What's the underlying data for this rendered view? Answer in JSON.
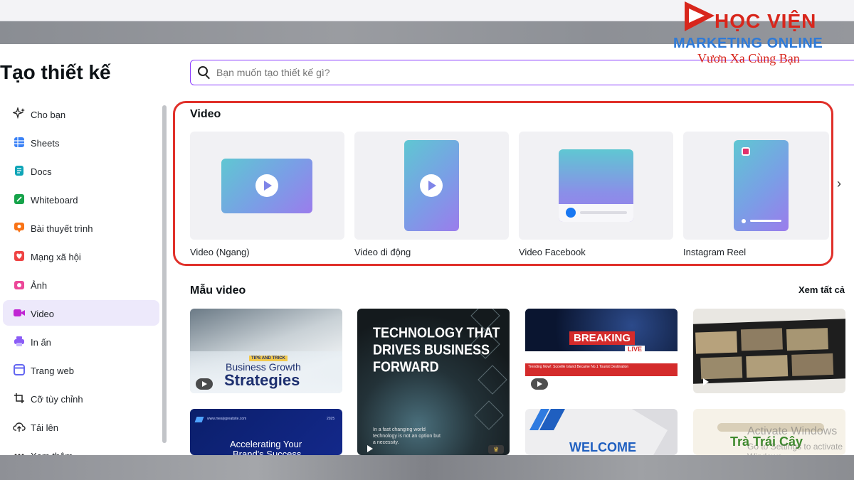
{
  "brand": {
    "line1": "HỌC VIỆN",
    "line2": "MARKETING ONLINE",
    "slogan": "Vươn Xa Cùng Bạn"
  },
  "page_title": "Tạo thiết kế",
  "search": {
    "placeholder": "Bạn muốn tạo thiết kế gì?"
  },
  "sidebar": {
    "items": [
      {
        "label": "Cho bạn",
        "icon": "sparkle-icon",
        "color": "#222222"
      },
      {
        "label": "Sheets",
        "icon": "sheets-icon",
        "color": "#3b82f6"
      },
      {
        "label": "Docs",
        "icon": "docs-icon",
        "color": "#0ea5b7"
      },
      {
        "label": "Whiteboard",
        "icon": "whiteboard-icon",
        "color": "#16a34a"
      },
      {
        "label": "Bài thuyết trình",
        "icon": "presentation-icon",
        "color": "#f97316"
      },
      {
        "label": "Mạng xã hội",
        "icon": "heart-icon",
        "color": "#ef4444"
      },
      {
        "label": "Ảnh",
        "icon": "camera-icon",
        "color": "#ec4899"
      },
      {
        "label": "Video",
        "icon": "video-icon",
        "color": "#c026d3",
        "active": true
      },
      {
        "label": "In ấn",
        "icon": "printer-icon",
        "color": "#8b5cf6"
      },
      {
        "label": "Trang web",
        "icon": "web-icon",
        "color": "#6366f1"
      },
      {
        "label": "Cỡ tùy chỉnh",
        "icon": "crop-icon",
        "color": "#222222"
      },
      {
        "label": "Tải lên",
        "icon": "cloud-upload-icon",
        "color": "#222222"
      },
      {
        "label": "Xem thêm",
        "icon": "more-icon",
        "color": "#222222"
      }
    ]
  },
  "video_section": {
    "title": "Video",
    "cards": [
      {
        "label": "Video (Ngang)"
      },
      {
        "label": "Video di động"
      },
      {
        "label": "Video Facebook"
      },
      {
        "label": "Instagram Reel"
      }
    ]
  },
  "templates_section": {
    "title": "Mẫu video",
    "see_all": "Xem tất cả",
    "templates": [
      {
        "tag": "TIPS AND TRICK",
        "line1": "Business Growth",
        "line2": "Strategies"
      },
      {
        "line1": "TECHNOLOGY THAT",
        "line2": "DRIVES BUSINESS",
        "line3": "FORWARD",
        "caption": "In a fast changing world technology is not an option but a necessity."
      },
      {
        "headline": "BREAKING",
        "badge": "LIVE",
        "ticker": "Trending Now!: Scoville Island Became No.1 Tourist Destination"
      },
      {
        "kind": "film-strip"
      },
      {
        "site": "www.mealygreatsite.com",
        "year": "2025",
        "line1": "Accelerating Your",
        "line2": "Brand's Success"
      },
      {
        "headline": "WELCOME"
      },
      {
        "line1": "Trà Trái Cây"
      }
    ]
  },
  "os_watermark": {
    "line1": "Activate Windows",
    "line2": "Go to Settings to activate Windows."
  }
}
